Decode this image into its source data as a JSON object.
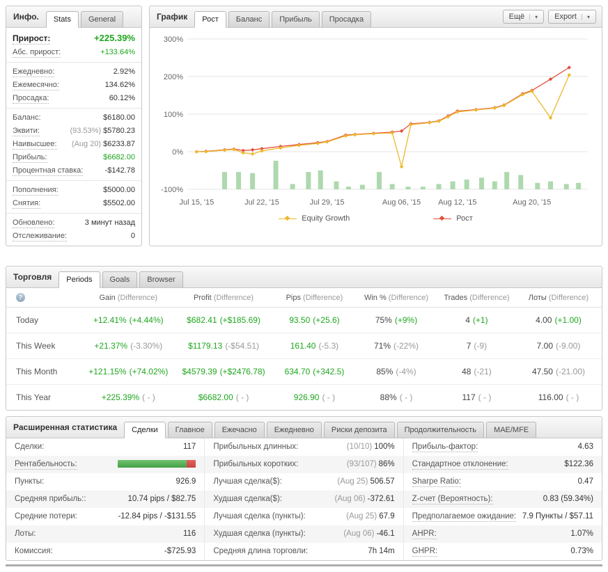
{
  "colors": {
    "green": "#1fa61f",
    "gray": "#999999",
    "dark": "#444444",
    "equity_line": "#edb82a",
    "growth_line": "#e2503c",
    "bar_fill": "#aed9ae",
    "grid": "#e4e4e4"
  },
  "icons": {
    "caret_down": "▾",
    "help": "?"
  },
  "info_panel": {
    "title": "Инфо.",
    "tabs": [
      {
        "name": "stats",
        "label": "Stats",
        "active": true
      },
      {
        "name": "general",
        "label": "General",
        "active": false
      }
    ],
    "sections": [
      {
        "rows": [
          {
            "label": "Прирост:",
            "value": "+225.39%",
            "value_color": "green",
            "emphasis": true,
            "underline": true
          },
          {
            "label": "Абс. прирост:",
            "value": "+133.64%",
            "value_color": "green",
            "underline": true
          }
        ]
      },
      {
        "rows": [
          {
            "label": "Ежедневно:",
            "value": "2.92%",
            "underline": true
          },
          {
            "label": "Ежемесячно:",
            "value": "134.62%",
            "underline": true
          },
          {
            "label": "Просадка:",
            "value": "60.12%",
            "underline": true
          }
        ]
      },
      {
        "rows": [
          {
            "label": "Баланс:",
            "value": "$6180.00",
            "underline": false
          },
          {
            "label": "Эквити:",
            "prefix": "(93.53%)",
            "value": "$5780.23",
            "underline": true
          },
          {
            "label": "Наивысшее:",
            "prefix": "(Aug 20)",
            "value": "$6233.87",
            "underline": true
          },
          {
            "label": "Прибыль:",
            "value": "$6682.00",
            "value_color": "green",
            "underline": true
          },
          {
            "label": "Процентная ставка:",
            "value": "-$142.78",
            "underline": true
          }
        ]
      },
      {
        "rows": [
          {
            "label": "Пополнения:",
            "value": "$5000.00",
            "underline": true
          },
          {
            "label": "Снятия:",
            "value": "$5502.00",
            "underline": true
          }
        ]
      },
      {
        "rows": [
          {
            "label": "Обновлено:",
            "value": "3 минут назад",
            "underline": true
          },
          {
            "label": "Отслеживание:",
            "value": "0",
            "underline": true
          }
        ]
      }
    ]
  },
  "chart_panel": {
    "title": "График",
    "tabs": [
      {
        "name": "growth",
        "label": "Рост",
        "active": true
      },
      {
        "name": "balance",
        "label": "Баланс",
        "active": false
      },
      {
        "name": "profit",
        "label": "Прибыль",
        "active": false
      },
      {
        "name": "drawdown",
        "label": "Просадка",
        "active": false
      }
    ],
    "more_label": "Ещё",
    "export_label": "Export",
    "legend": [
      {
        "label": "Equity Growth",
        "color": "#edb82a"
      },
      {
        "label": "Рост",
        "color": "#e2503c"
      }
    ]
  },
  "chart_data": {
    "type": "line",
    "title": "Growth",
    "xlabel": "",
    "ylabel": "",
    "ylim": [
      -100,
      300
    ],
    "yticks": [
      300,
      200,
      100,
      0,
      -100
    ],
    "ytick_labels": [
      "300%",
      "200%",
      "100%",
      "0%",
      "-100%"
    ],
    "x_range": [
      -1,
      42
    ],
    "xticks": [
      0,
      7,
      14,
      22,
      28,
      36
    ],
    "xtick_labels": [
      "Jul 15, '15",
      "Jul 22, '15",
      "Jul 29, '15",
      "Aug 06, '15",
      "Aug 12, '15",
      "Aug 20, '15"
    ],
    "grid": true,
    "legend_position": "bottom",
    "series": [
      {
        "name": "Рост",
        "color": "#e2503c",
        "x": [
          0,
          1,
          3,
          4,
          5,
          6,
          7,
          9,
          11,
          13,
          14,
          16,
          17,
          19,
          21,
          22,
          23,
          25,
          26,
          27,
          28,
          30,
          32,
          33,
          35,
          36,
          38,
          40
        ],
        "y": [
          0,
          1,
          5,
          7,
          3,
          5,
          8,
          14,
          19,
          24,
          27,
          44,
          46,
          49,
          52,
          55,
          74,
          78,
          82,
          95,
          108,
          112,
          117,
          124,
          154,
          163,
          193,
          224
        ]
      },
      {
        "name": "Equity Growth",
        "color": "#edb82a",
        "x": [
          0,
          1,
          3,
          4,
          5,
          6,
          7,
          9,
          11,
          13,
          14,
          16,
          17,
          19,
          21,
          22,
          23,
          25,
          26,
          27,
          28,
          30,
          32,
          33,
          35,
          36,
          38,
          40
        ],
        "y": [
          0,
          0,
          4,
          6,
          -3,
          -6,
          2,
          10,
          17,
          22,
          26,
          42,
          45,
          48,
          50,
          -40,
          72,
          77,
          81,
          93,
          106,
          111,
          116,
          123,
          152,
          161,
          90,
          204
        ]
      }
    ],
    "bars": {
      "name": "volume",
      "baseline": -100,
      "x": [
        3,
        4.5,
        6,
        8.5,
        10.3,
        12,
        13.3,
        15,
        16.3,
        17.8,
        19.6,
        21,
        22.7,
        24.3,
        26,
        27.5,
        29,
        30.6,
        32,
        33.3,
        34.8,
        36.6,
        38,
        39.7,
        41
      ],
      "height": [
        46,
        46,
        43,
        76,
        14,
        46,
        50,
        21,
        7,
        12,
        46,
        14,
        7,
        7,
        14,
        21,
        26,
        31,
        21,
        46,
        38,
        17,
        21,
        14,
        17
      ]
    }
  },
  "trading_panel": {
    "title": "Торговля",
    "tabs": [
      {
        "name": "periods",
        "label": "Periods",
        "active": true
      },
      {
        "name": "goals",
        "label": "Goals",
        "active": false
      },
      {
        "name": "browser",
        "label": "Browser",
        "active": false
      }
    ],
    "columns": [
      {
        "main": "Gain",
        "sub": "(Difference)"
      },
      {
        "main": "Profit",
        "sub": "(Difference)"
      },
      {
        "main": "Pips",
        "sub": "(Difference)"
      },
      {
        "main": "Win %",
        "sub": "(Difference)"
      },
      {
        "main": "Trades",
        "sub": "(Difference)"
      },
      {
        "main": "Лоты",
        "sub": "(Difference)"
      }
    ],
    "rows": [
      {
        "period": "Today",
        "cells": [
          {
            "v": "+12.41%",
            "vc": "green",
            "d": "(+4.44%)",
            "dc": "green"
          },
          {
            "v": "$682.41",
            "vc": "green",
            "d": "(+$185.69)",
            "dc": "green"
          },
          {
            "v": "93.50",
            "vc": "green",
            "d": "(+25.6)",
            "dc": "green"
          },
          {
            "v": "75%",
            "vc": "dark",
            "d": "(+9%)",
            "dc": "green"
          },
          {
            "v": "4",
            "vc": "dark",
            "d": "(+1)",
            "dc": "green"
          },
          {
            "v": "4.00",
            "vc": "dark",
            "d": "(+1.00)",
            "dc": "green"
          }
        ]
      },
      {
        "period": "This Week",
        "cells": [
          {
            "v": "+21.37%",
            "vc": "green",
            "d": "(-3.30%)",
            "dc": "gray"
          },
          {
            "v": "$1179.13",
            "vc": "green",
            "d": "(-$54.51)",
            "dc": "gray"
          },
          {
            "v": "161.40",
            "vc": "green",
            "d": "(-5.3)",
            "dc": "gray"
          },
          {
            "v": "71%",
            "vc": "dark",
            "d": "(-22%)",
            "dc": "gray"
          },
          {
            "v": "7",
            "vc": "dark",
            "d": "(-9)",
            "dc": "gray"
          },
          {
            "v": "7.00",
            "vc": "dark",
            "d": "(-9.00)",
            "dc": "gray"
          }
        ]
      },
      {
        "period": "This Month",
        "cells": [
          {
            "v": "+121.15%",
            "vc": "green",
            "d": "(+74.02%)",
            "dc": "green"
          },
          {
            "v": "$4579.39",
            "vc": "green",
            "d": "(+$2476.78)",
            "dc": "green"
          },
          {
            "v": "634.70",
            "vc": "green",
            "d": "(+342.5)",
            "dc": "green"
          },
          {
            "v": "85%",
            "vc": "dark",
            "d": "(-4%)",
            "dc": "gray"
          },
          {
            "v": "48",
            "vc": "dark",
            "d": "(-21)",
            "dc": "gray"
          },
          {
            "v": "47.50",
            "vc": "dark",
            "d": "(-21.00)",
            "dc": "gray"
          }
        ]
      },
      {
        "period": "This Year",
        "cells": [
          {
            "v": "+225.39%",
            "vc": "green",
            "d": "( - )",
            "dc": "gray"
          },
          {
            "v": "$6682.00",
            "vc": "green",
            "d": "( - )",
            "dc": "gray"
          },
          {
            "v": "926.90",
            "vc": "green",
            "d": "( - )",
            "dc": "gray"
          },
          {
            "v": "88%",
            "vc": "dark",
            "d": "( - )",
            "dc": "gray"
          },
          {
            "v": "117",
            "vc": "dark",
            "d": "( - )",
            "dc": "gray"
          },
          {
            "v": "116.00",
            "vc": "dark",
            "d": "( - )",
            "dc": "gray"
          }
        ]
      }
    ]
  },
  "stats_panel": {
    "title": "Расширенная статистика",
    "tabs": [
      {
        "name": "trades",
        "label": "Сделки",
        "active": true
      },
      {
        "name": "main",
        "label": "Главное",
        "active": false
      },
      {
        "name": "hourly",
        "label": "Ежечасно",
        "active": false
      },
      {
        "name": "daily",
        "label": "Ежедневно",
        "active": false
      },
      {
        "name": "deposit-risks",
        "label": "Риски депозита",
        "active": false
      },
      {
        "name": "duration",
        "label": "Продолжительность",
        "active": false
      },
      {
        "name": "mae-mfe",
        "label": "MAE/MFE",
        "active": false
      }
    ],
    "columns": [
      {
        "rows": [
          {
            "label": "Сделки:",
            "value": "117"
          },
          {
            "label": "Рентабельность:",
            "bar": {
              "green_pct": 88,
              "red_pct": 12
            },
            "underline": true
          },
          {
            "label": "Пункты:",
            "value": "926.9"
          },
          {
            "label": "Средняя прибыль::",
            "value": "10.74 pips / $82.75"
          },
          {
            "label": "Средние потери:",
            "value": "-12.84 pips / -$131.55"
          },
          {
            "label": "Лоты:",
            "value": "116"
          },
          {
            "label": "Комиссия:",
            "value": "-$725.93"
          }
        ]
      },
      {
        "rows": [
          {
            "label": "Прибыльных длинных:",
            "prefix": "(10/10)",
            "value": "100%"
          },
          {
            "label": "Прибыльных коротких:",
            "prefix": "(93/107)",
            "value": "86%"
          },
          {
            "label": "Лучшая сделка($):",
            "prefix": "(Aug 25)",
            "value": "506.57"
          },
          {
            "label": "Худшая сделка($):",
            "prefix": "(Aug 06)",
            "value": "-372.61"
          },
          {
            "label": "Лучшая сделка (пункты):",
            "prefix": "(Aug 25)",
            "value": "67.9"
          },
          {
            "label": "Худшая сделка (пункты):",
            "prefix": "(Aug 06)",
            "value": "-46.1"
          },
          {
            "label": "Средняя длина торговли:",
            "value": "7h 14m"
          }
        ]
      },
      {
        "rows": [
          {
            "label": "Прибыль-фактор:",
            "value": "4.63",
            "underline": true
          },
          {
            "label": "Стандартное отклонение:",
            "value": "$122.36",
            "underline": true
          },
          {
            "label": "Sharpe Ratio:",
            "value": "0.47",
            "underline": true
          },
          {
            "label": "Z-счет (Вероятность):",
            "value": "0.83 (59.34%)",
            "underline": true
          },
          {
            "label": "Предполагаемое ожидание:",
            "value": "7.9 Пункты / $57.11",
            "underline": true
          },
          {
            "label": "AHPR:",
            "value": "1.07%",
            "underline": true
          },
          {
            "label": "GHPR:",
            "value": "0.73%",
            "underline": true
          }
        ]
      }
    ]
  }
}
